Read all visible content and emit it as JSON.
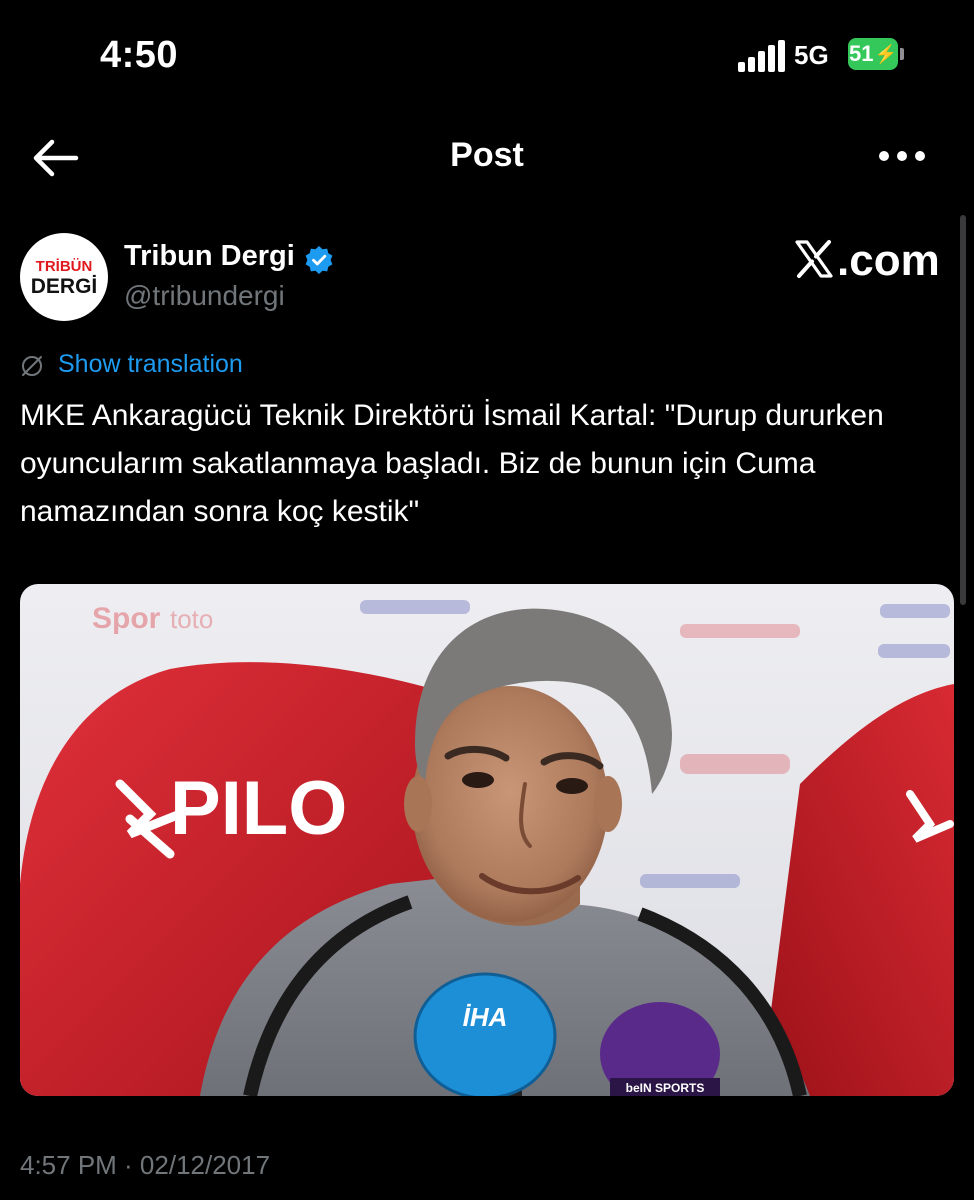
{
  "status_bar": {
    "time": "4:50",
    "network": "5G",
    "battery": "51"
  },
  "nav": {
    "title": "Post"
  },
  "author": {
    "display_name": "Tribun Dergi",
    "handle": "@tribundergi",
    "avatar_text_top": "TRİBÜN",
    "avatar_text_bottom": "DERGİ"
  },
  "watermark": ".com",
  "translate_label": "Show translation",
  "tweet_text": "MKE Ankaragücü Teknik Direktörü İsmail Kartal: \"Durup dururken oyuncularım sakatlanmaya başladı. Biz de bunun için Cuma namazından sonra koç kestik\"",
  "media": {
    "chair_text_main": "PILO",
    "mic_ihlas_text": "İHA",
    "mic_bein_text": "beIN SPORTS"
  },
  "timestamp": "4:57 PM · 02/12/2017",
  "colors": {
    "accent": "#1d9bf0",
    "secondary_text": "#71767b",
    "battery": "#34c759"
  }
}
